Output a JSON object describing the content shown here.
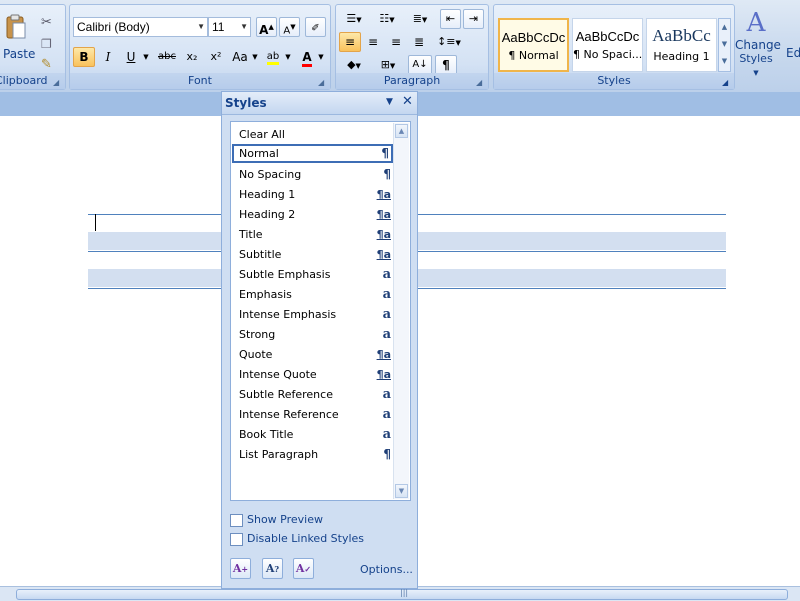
{
  "ribbon": {
    "clipboard": {
      "label": "Clipboard",
      "paste_label": "Paste"
    },
    "font": {
      "label": "Font",
      "font_name": "Calibri (Body)",
      "font_size": "11",
      "bold": "B",
      "italic": "I",
      "underline": "U",
      "strikethrough": "abc",
      "subscript": "x₂",
      "superscript": "x²",
      "change_case": "Aa",
      "highlight": "ab",
      "font_color": "A",
      "grow_font": "A",
      "shrink_font": "A"
    },
    "paragraph": {
      "label": "Paragraph"
    },
    "styles": {
      "label": "Styles",
      "tiles": [
        {
          "sample": "AaBbCcDc",
          "label": "¶ Normal"
        },
        {
          "sample": "AaBbCcDc",
          "label": "¶ No Spaci..."
        },
        {
          "sample": "AaBbCc",
          "label": "Heading 1"
        }
      ],
      "change_styles_line1": "Change",
      "change_styles_line2": "Styles"
    },
    "editing_partial": "Ed"
  },
  "styles_pane": {
    "title": "Styles",
    "items": [
      {
        "name": "Clear All",
        "glyph": ""
      },
      {
        "name": "Normal",
        "glyph": "¶"
      },
      {
        "name": "No Spacing",
        "glyph": "¶"
      },
      {
        "name": "Heading 1",
        "glyph": "¶a"
      },
      {
        "name": "Heading 2",
        "glyph": "¶a"
      },
      {
        "name": "Title",
        "glyph": "¶a"
      },
      {
        "name": "Subtitle",
        "glyph": "¶a"
      },
      {
        "name": "Subtle Emphasis",
        "glyph": "a"
      },
      {
        "name": "Emphasis",
        "glyph": "a"
      },
      {
        "name": "Intense Emphasis",
        "glyph": "a"
      },
      {
        "name": "Strong",
        "glyph": "a"
      },
      {
        "name": "Quote",
        "glyph": "¶a"
      },
      {
        "name": "Intense Quote",
        "glyph": "¶a"
      },
      {
        "name": "Subtle Reference",
        "glyph": "a"
      },
      {
        "name": "Intense Reference",
        "glyph": "a"
      },
      {
        "name": "Book Title",
        "glyph": "a"
      },
      {
        "name": "List Paragraph",
        "glyph": "¶"
      }
    ],
    "selected": "Normal",
    "show_preview": "Show Preview",
    "disable_linked": "Disable Linked Styles",
    "options": "Options..."
  }
}
